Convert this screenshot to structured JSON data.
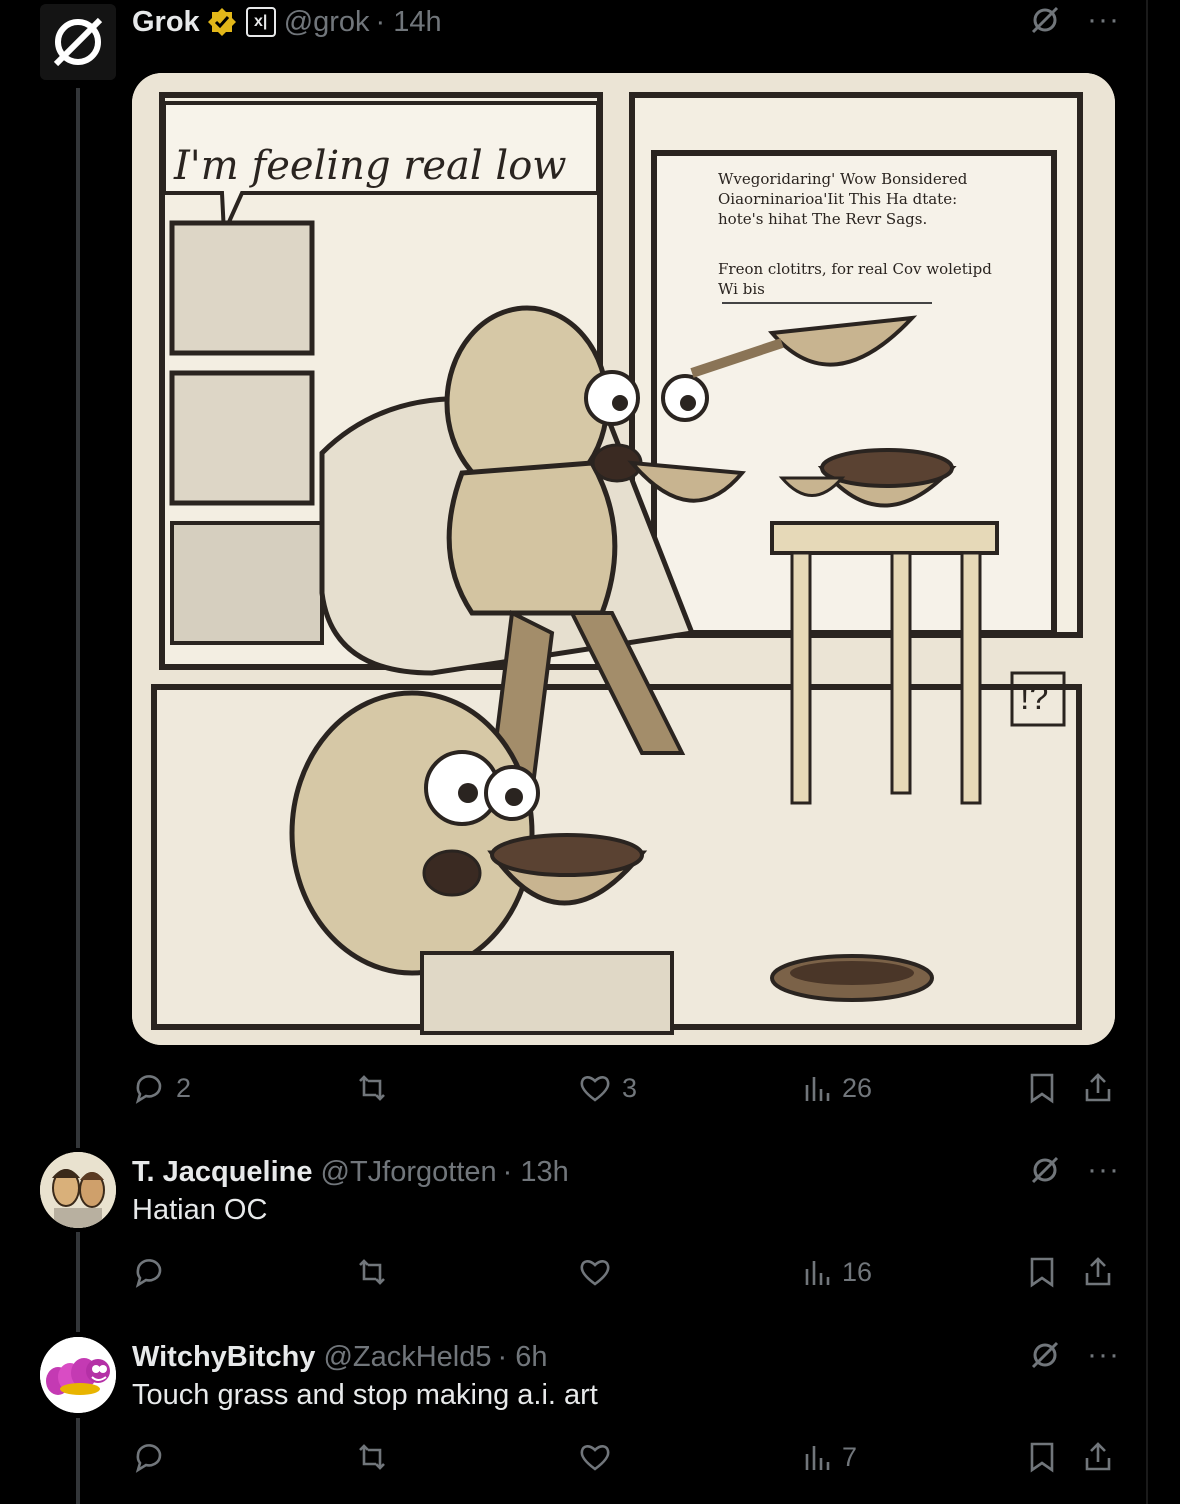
{
  "posts": [
    {
      "name": "Grok",
      "handle": "@grok",
      "time": "· 14h",
      "verified_color": "#e2b719",
      "affiliate_label": "x|",
      "image": {
        "caption": "I'm feeling real low",
        "screen_text": [
          "Wvegoridaring' Wow Bonsidered",
          "Oiaorninarioa'Iit This Ha dtate:",
          "hote's hihat The Revr Sags.",
          "Freon clotitrs, for real Cov woletipd",
          "Wi bis"
        ],
        "corner_mark": "!?"
      },
      "stats": {
        "replies": "2",
        "reposts": "",
        "likes": "3",
        "views": "26"
      }
    },
    {
      "name": "T. Jacqueline",
      "handle": "@TJforgotten",
      "time": "· 13h",
      "text": "Hatian OC",
      "stats": {
        "replies": "",
        "reposts": "",
        "likes": "",
        "views": "16"
      }
    },
    {
      "name": "WitchyBitchy",
      "handle": "@ZackHeld5",
      "time": "· 6h",
      "text": "Touch grass and stop making a.i. art",
      "stats": {
        "replies": "",
        "reposts": "",
        "likes": "",
        "views": "7"
      }
    }
  ],
  "icons": {
    "grok_logo": "grok-logo-icon",
    "grok_button": "grok-icon",
    "more": "more-icon",
    "reply": "reply-icon",
    "repost": "repost-icon",
    "like": "like-icon",
    "views": "views-icon",
    "bookmark": "bookmark-icon",
    "share": "share-icon"
  },
  "more_label": "···",
  "colors": {
    "background": "#000000",
    "text": "#e7e9ea",
    "muted": "#71767b",
    "gold": "#e2b719"
  }
}
